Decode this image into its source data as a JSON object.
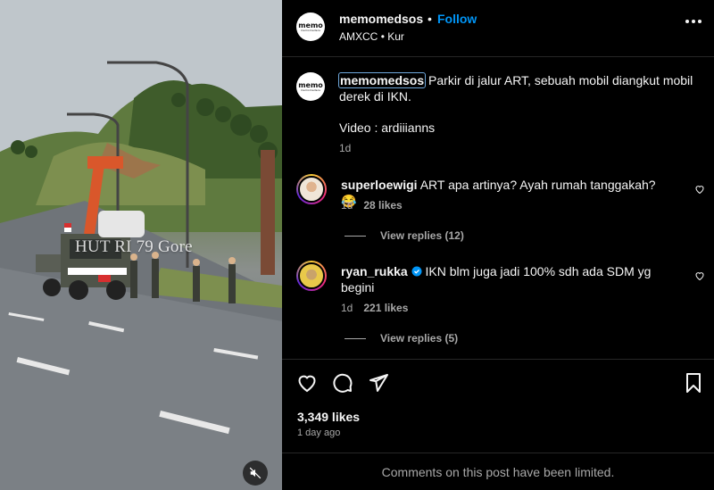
{
  "video": {
    "watermark": "HUT RI 79 Gore",
    "mute_icon": "speaker-muted-icon"
  },
  "header": {
    "username": "memomedsos",
    "separator": "•",
    "follow_label": "Follow",
    "audio": "AMXCC",
    "audio_sep": "•",
    "audio_track": "Kur",
    "avatar_text": "memo",
    "more_icon": "more-options-icon"
  },
  "caption": {
    "username": "memomedsos",
    "text": " Parkir di jalur ART, sebuah mobil diangkut mobil derek di IKN.",
    "credit": "Video : ardiiianns",
    "time": "1d"
  },
  "comments": [
    {
      "username": "superloewigi",
      "text": " ART apa artinya? Ayah rumah tanggakah? 😂",
      "time": "1d",
      "likes": "28 likes",
      "replies": "View replies (12)",
      "verified": false
    },
    {
      "username": "ryan_rukka",
      "text": " IKN blm juga jadi 100% sdh ada SDM yg begini",
      "time": "1d",
      "likes": "221 likes",
      "replies": "View replies (5)",
      "verified": true
    }
  ],
  "actions": {
    "like_icon": "heart-icon",
    "comment_icon": "comment-icon",
    "share_icon": "share-icon",
    "save_icon": "bookmark-icon",
    "likes": "3,349 likes",
    "posted": "1 day ago"
  },
  "footer": {
    "limited": "Comments on this post have been limited."
  },
  "colors": {
    "accent": "#0095f6",
    "background": "#000000",
    "muted_text": "#a8a8a8",
    "verified": "#0095f6"
  }
}
